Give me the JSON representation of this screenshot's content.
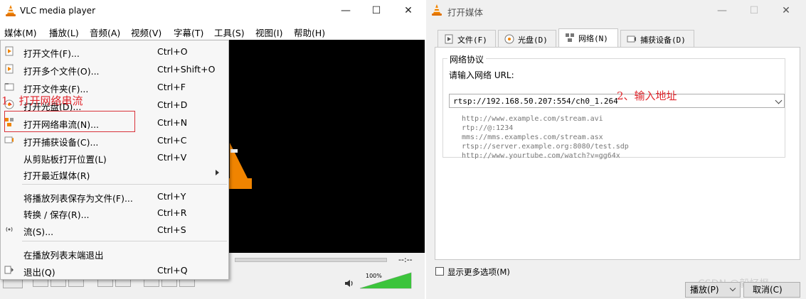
{
  "vlc": {
    "title": "VLC media player",
    "menubar": [
      "媒体(M)",
      "播放(L)",
      "音频(A)",
      "视频(V)",
      "字幕(T)",
      "工具(S)",
      "视图(I)",
      "帮助(H)"
    ],
    "media_menu": [
      {
        "label": "打开文件(F)...",
        "shortcut": "Ctrl+O",
        "icon": "file-icon"
      },
      {
        "label": "打开多个文件(O)...",
        "shortcut": "Ctrl+Shift+O",
        "icon": "files-icon"
      },
      {
        "label": "打开文件夹(F)...",
        "shortcut": "Ctrl+F",
        "icon": "folder-icon"
      },
      {
        "label": "打开光盘(D)...",
        "shortcut": "Ctrl+D",
        "icon": "disc-icon"
      },
      {
        "label": "打开网络串流(N)...",
        "shortcut": "Ctrl+N",
        "icon": "network-icon"
      },
      {
        "label": "打开捕获设备(C)...",
        "shortcut": "Ctrl+C",
        "icon": "capture-icon"
      },
      {
        "label": "从剪贴板打开位置(L)",
        "shortcut": "Ctrl+V",
        "icon": ""
      },
      {
        "label": "打开最近媒体(R)",
        "shortcut": "",
        "icon": ""
      },
      {
        "label": "将播放列表保存为文件(F)...",
        "shortcut": "Ctrl+Y",
        "icon": ""
      },
      {
        "label": "转换 / 保存(R)...",
        "shortcut": "Ctrl+R",
        "icon": ""
      },
      {
        "label": "流(S)...",
        "shortcut": "Ctrl+S",
        "icon": "stream-icon"
      },
      {
        "label": "在播放列表末端退出",
        "shortcut": "",
        "icon": ""
      },
      {
        "label": "退出(Q)",
        "shortcut": "Ctrl+Q",
        "icon": "exit-icon"
      }
    ],
    "time_display": "--:--",
    "volume_label": "100%",
    "volume_level": 1.0
  },
  "annotations": {
    "step1": "1、打开网络串流",
    "step2": "2、输入地址"
  },
  "dialog": {
    "title": "打开媒体",
    "tabs": [
      "文件(F)",
      "光盘(D)",
      "网络(N)",
      "捕获设备(D)"
    ],
    "active_tab": 2,
    "group_title": "网络协议",
    "url_label": "请输入网络 URL:",
    "url_value": "rtsp://192.168.50.207:554/ch0_1.264",
    "examples": [
      "http://www.example.com/stream.avi",
      "rtp://@:1234",
      "mms://mms.examples.com/stream.asx",
      "rtsp://server.example.org:8080/test.sdp",
      "http://www.yourtube.com/watch?v=gg64x"
    ],
    "show_more": "显示更多选项(M)",
    "play_button": "播放(P)",
    "cancel_button": "取消(C)"
  },
  "watermark": "CSDN @毅忆枫",
  "colors": {
    "annotation_red": "#e0262d",
    "vlc_orange": "#f08400",
    "volume_green": "#3cc43c"
  }
}
